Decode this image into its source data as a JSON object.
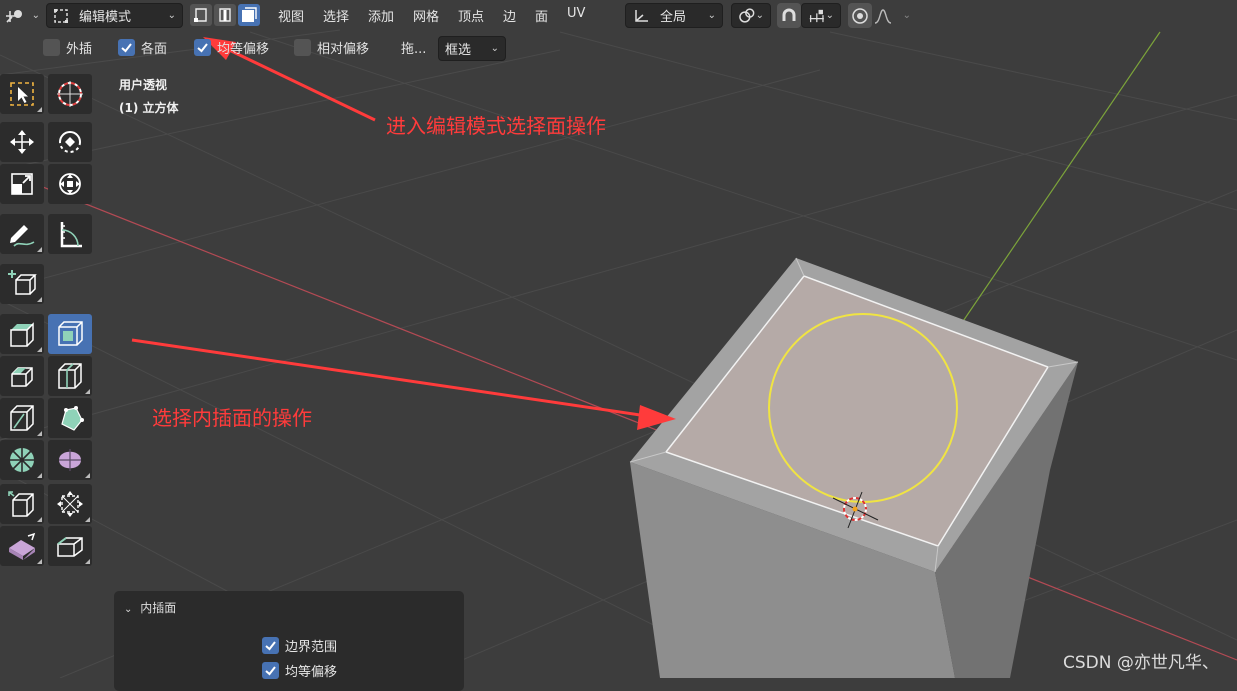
{
  "header": {
    "mode_label": "编辑模式",
    "menus": [
      "视图",
      "选择",
      "添加",
      "网格",
      "顶点",
      "边",
      "面",
      "UV"
    ],
    "transform_orientation": "全局"
  },
  "toolbar_options": {
    "extrude_label": "外插",
    "each_face_label": "各面",
    "even_offset_label": "均等偏移",
    "relative_offset_label": "相对偏移",
    "drag_label": "拖...",
    "select_mode": "框选"
  },
  "viewport": {
    "view_name": "用户透视",
    "object_name": "(1) 立方体"
  },
  "annotations": {
    "edit_mode_note": "进入编辑模式选择面操作",
    "inset_note": "选择内插面的操作"
  },
  "operator_panel": {
    "title": "内插面",
    "boundary_label": "边界范围",
    "even_offset_label": "均等偏移"
  },
  "watermark": "CSDN @亦世凡华、",
  "colors": {
    "accent": "#4772b3",
    "annotation": "#ff3b3b",
    "x_axis": "#b34a54",
    "y_axis": "#7ca43a",
    "selected_face": "#b5aaa7",
    "brush_circle": "#f0e442"
  },
  "tools": [
    "select-box-icon",
    "cursor-icon",
    "move-icon",
    "rotate-icon",
    "scale-icon",
    "transform-icon",
    "annotate-icon",
    "measure-icon",
    "add-cube-icon",
    "extrude-region-icon",
    "inset-faces-icon",
    "bevel-icon",
    "loop-cut-icon",
    "knife-icon",
    "poly-build-icon",
    "spin-icon",
    "smooth-icon",
    "edge-slide-icon",
    "shrink-fatten-icon",
    "shear-icon",
    "rip-region-icon"
  ]
}
